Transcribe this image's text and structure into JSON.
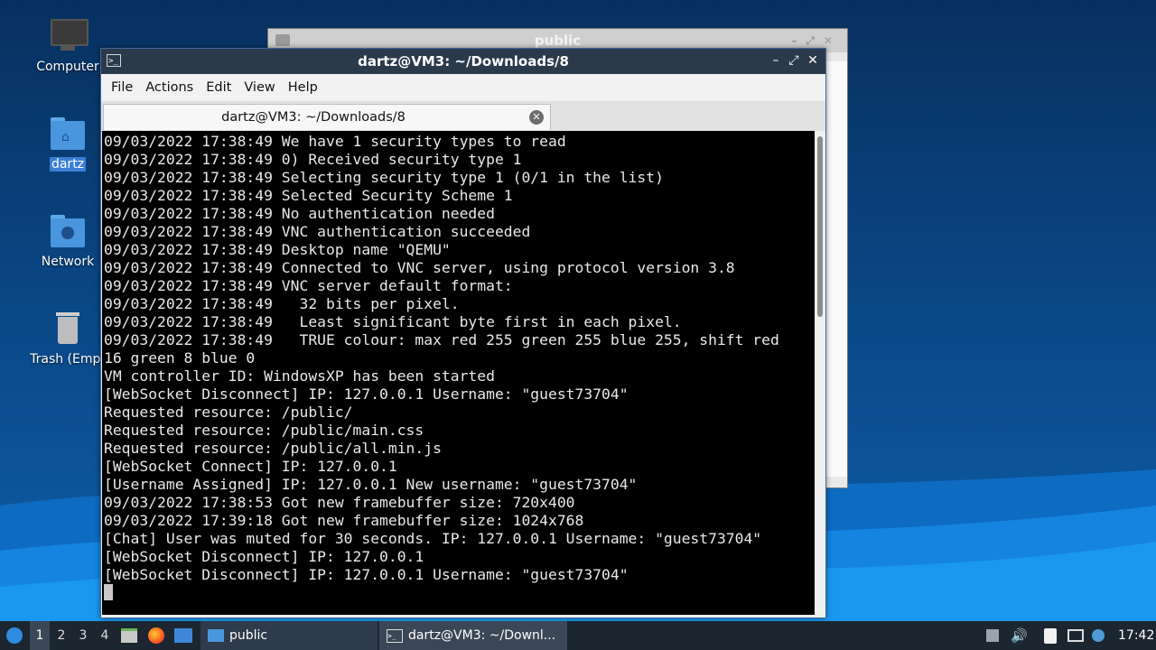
{
  "desktop": {
    "icons": [
      {
        "label": "Computer"
      },
      {
        "label": "dartz"
      },
      {
        "label": "Network"
      },
      {
        "label": "Trash (Empt"
      }
    ]
  },
  "background_window": {
    "title": "public"
  },
  "terminal": {
    "title": "dartz@VM3: ~/Downloads/8",
    "menu": [
      "File",
      "Actions",
      "Edit",
      "View",
      "Help"
    ],
    "tab_label": "dartz@VM3: ~/Downloads/8",
    "lines": [
      "09/03/2022 17:38:49 We have 1 security types to read",
      "09/03/2022 17:38:49 0) Received security type 1",
      "09/03/2022 17:38:49 Selecting security type 1 (0/1 in the list)",
      "09/03/2022 17:38:49 Selected Security Scheme 1",
      "09/03/2022 17:38:49 No authentication needed",
      "09/03/2022 17:38:49 VNC authentication succeeded",
      "09/03/2022 17:38:49 Desktop name \"QEMU\"",
      "09/03/2022 17:38:49 Connected to VNC server, using protocol version 3.8",
      "09/03/2022 17:38:49 VNC server default format:",
      "09/03/2022 17:38:49   32 bits per pixel.",
      "09/03/2022 17:38:49   Least significant byte first in each pixel.",
      "09/03/2022 17:38:49   TRUE colour: max red 255 green 255 blue 255, shift red",
      "16 green 8 blue 0",
      "VM controller ID: WindowsXP has been started",
      "[WebSocket Disconnect] IP: 127.0.0.1 Username: \"guest73704\"",
      "Requested resource: /public/",
      "Requested resource: /public/main.css",
      "Requested resource: /public/all.min.js",
      "[WebSocket Connect] IP: 127.0.0.1",
      "[Username Assigned] IP: 127.0.0.1 New username: \"guest73704\"",
      "09/03/2022 17:38:53 Got new framebuffer size: 720x400",
      "09/03/2022 17:39:18 Got new framebuffer size: 1024x768",
      "[Chat] User was muted for 30 seconds. IP: 127.0.0.1 Username: \"guest73704\"",
      "[WebSocket Disconnect] IP: 127.0.0.1",
      "[WebSocket Disconnect] IP: 127.0.0.1 Username: \"guest73704\""
    ]
  },
  "taskbar": {
    "workspaces": [
      "1",
      "2",
      "3",
      "4"
    ],
    "active_workspace": "1",
    "tasks": [
      {
        "label": "public"
      },
      {
        "label": "dartz@VM3: ~/Downl..."
      }
    ],
    "clock": "17:42"
  }
}
